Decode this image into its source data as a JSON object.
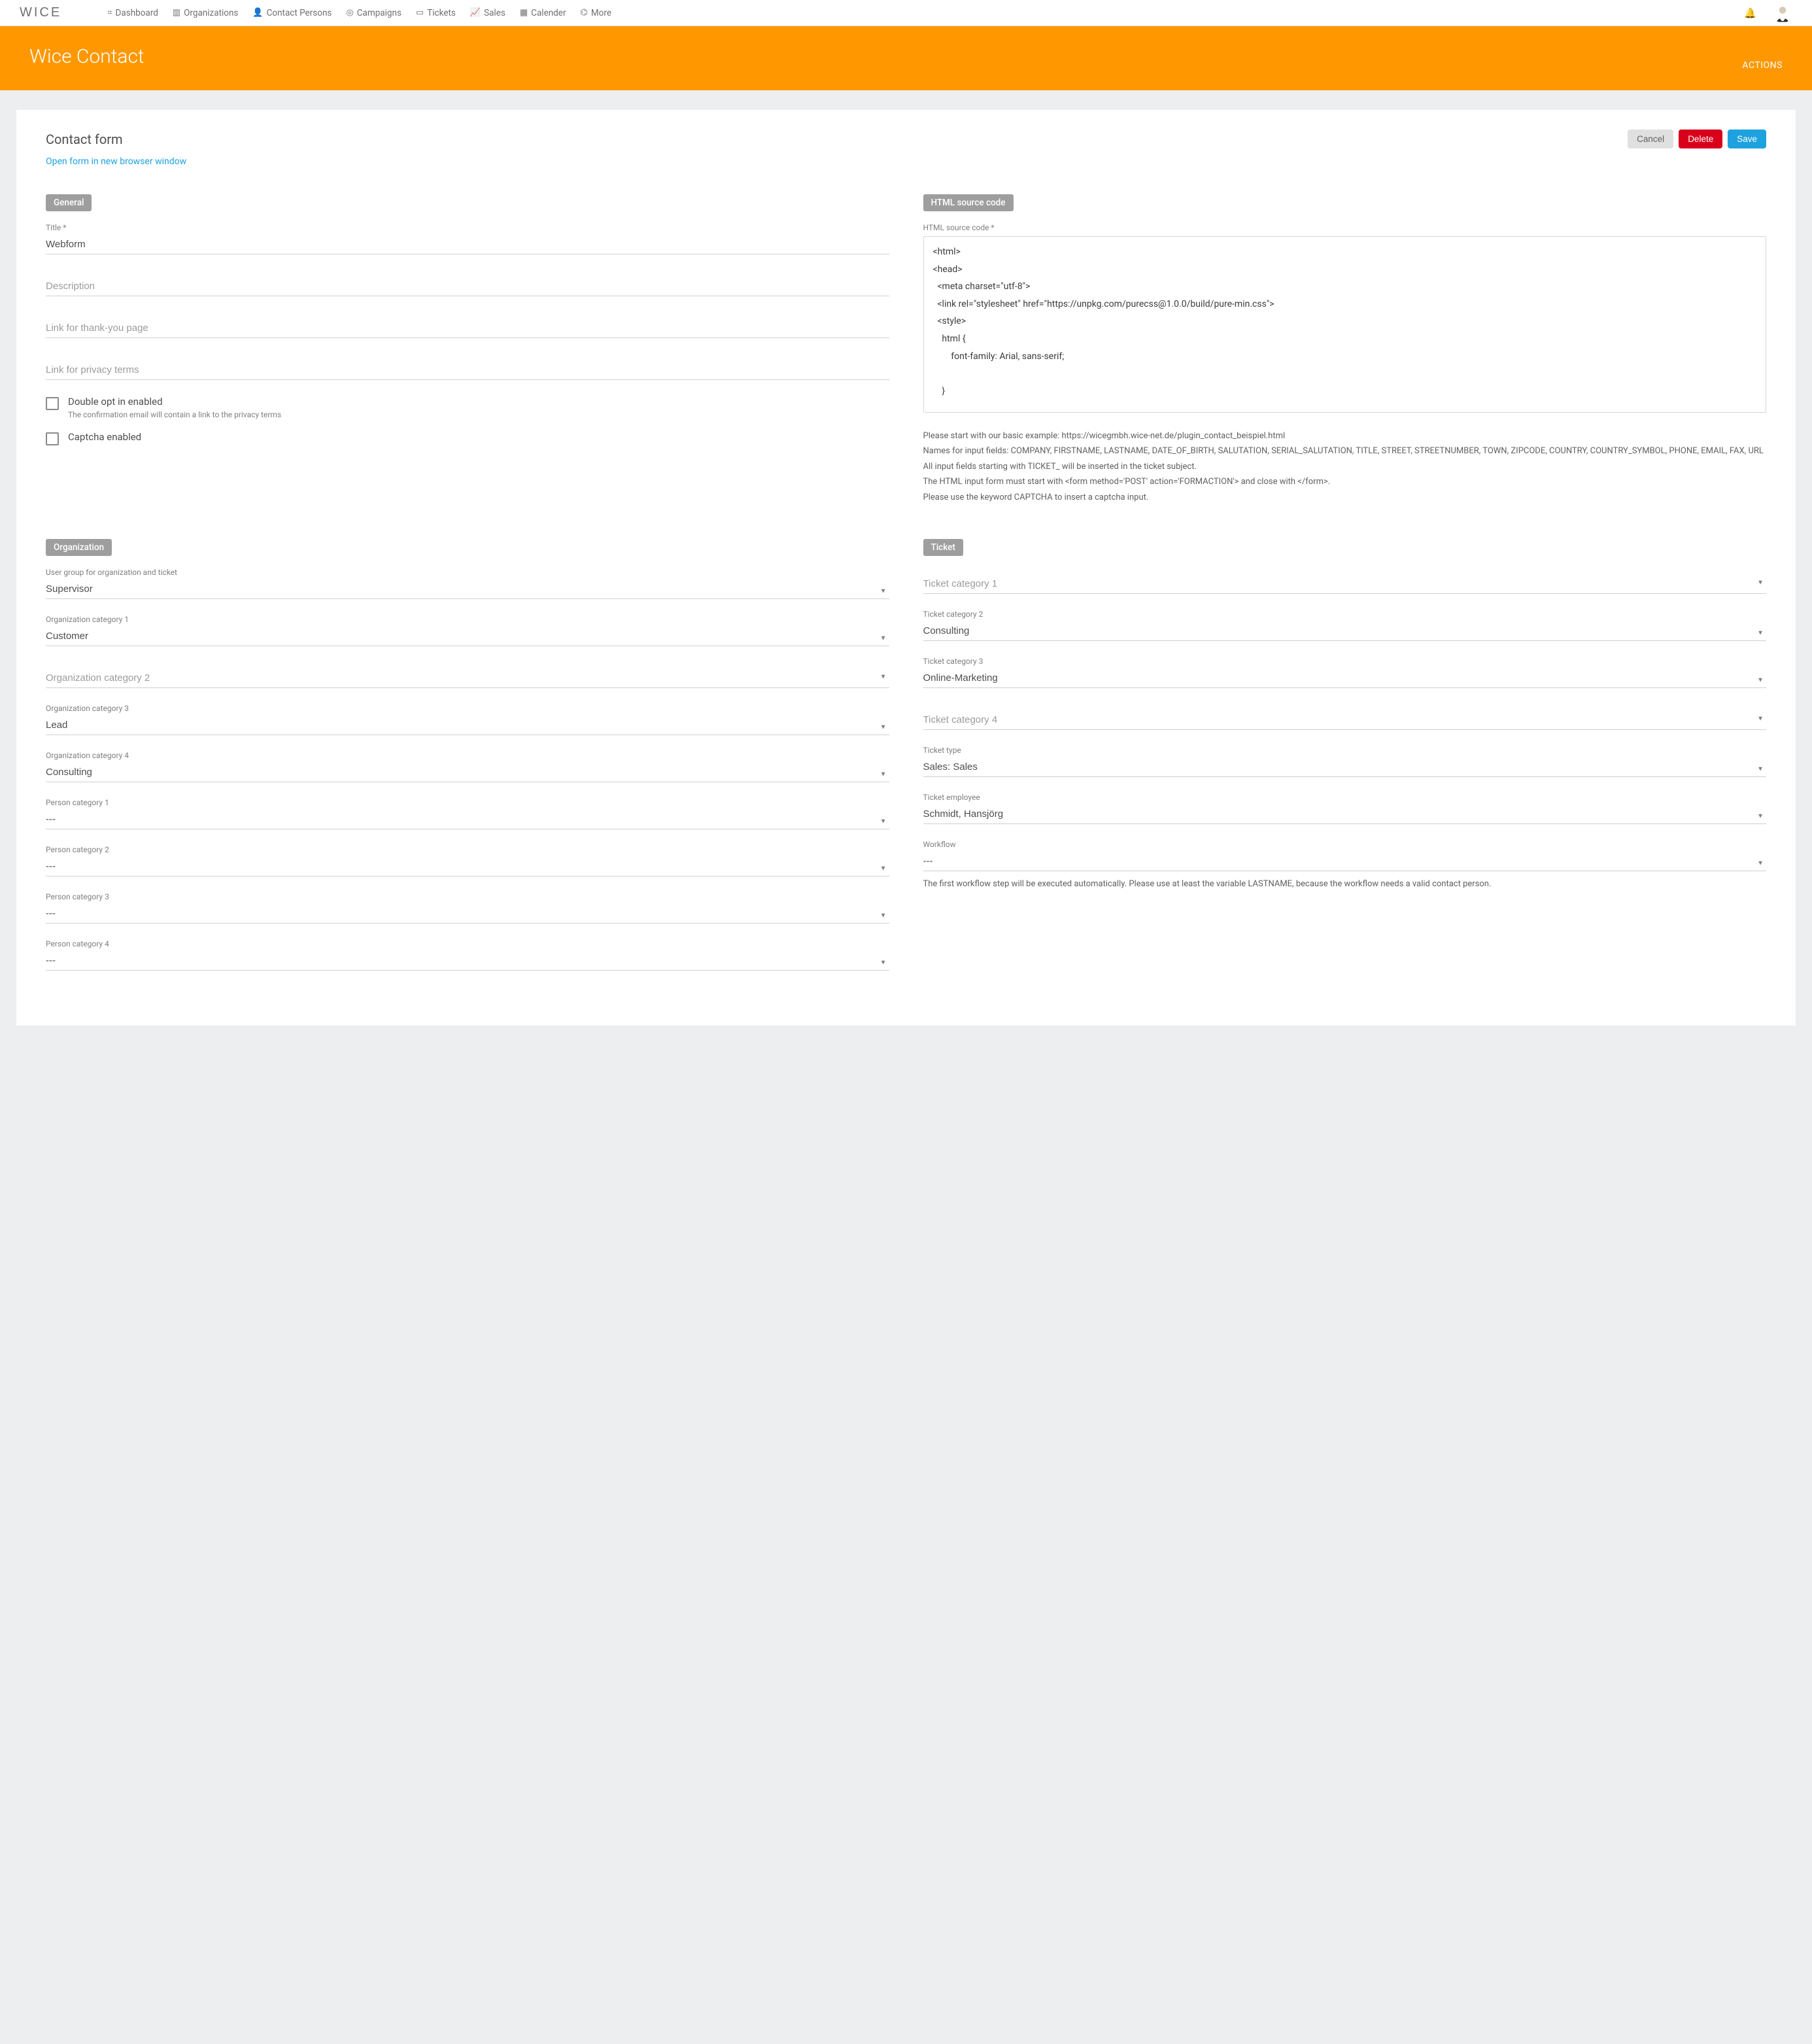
{
  "nav": {
    "logo": "WICE",
    "items": [
      {
        "icon": "dashboard",
        "label": "Dashboard"
      },
      {
        "icon": "building",
        "label": "Organizations"
      },
      {
        "icon": "user",
        "label": "Contact Persons"
      },
      {
        "icon": "target",
        "label": "Campaigns"
      },
      {
        "icon": "briefcase",
        "label": "Tickets"
      },
      {
        "icon": "chart",
        "label": "Sales"
      },
      {
        "icon": "calendar",
        "label": "Calender"
      },
      {
        "icon": "sitemap",
        "label": "More"
      }
    ]
  },
  "hero": {
    "title": "Wice Contact",
    "actions": "ACTIONS"
  },
  "card": {
    "title": "Contact form",
    "buttons": {
      "cancel": "Cancel",
      "delete": "Delete",
      "save": "Save"
    },
    "open_link": "Open form in new browser window"
  },
  "general": {
    "badge": "General",
    "title_label": "Title *",
    "title_value": "Webform",
    "description_placeholder": "Description",
    "thankyou_placeholder": "Link for thank-you page",
    "privacy_placeholder": "Link for privacy terms",
    "double_optin": {
      "label": "Double opt in enabled",
      "sub": "The confirmation email will contain a link to the privacy terms"
    },
    "captcha_label": "Captcha enabled"
  },
  "source": {
    "badge": "HTML source code",
    "label": "HTML source code *",
    "code": "<html>\n<head>\n  <meta charset=\"utf-8\">\n  <link rel=\"stylesheet\" href=\"https://unpkg.com/purecss@1.0.0/build/pure-min.css\">\n  <style>\n    html {\n        font-family: Arial, sans-serif;\n\n    }",
    "help": {
      "line1": "Please start with our basic example: https://wicegmbh.wice-net.de/plugin_contact_beispiel.html",
      "line2": "Names for input fields: COMPANY, FIRSTNAME, LASTNAME, DATE_OF_BIRTH, SALUTATION, SERIAL_SALUTATION, TITLE, STREET, STREETNUMBER, TOWN, ZIPCODE, COUNTRY, COUNTRY_SYMBOL, PHONE, EMAIL, FAX, URL",
      "line3": "All input fields starting with TICKET_ will be inserted in the ticket subject.",
      "line4": "The HTML input form must start with <form method='POST' action='FORMACTION'> and close with </form>.",
      "line5": "Please use the keyword CAPTCHA to insert a captcha input."
    }
  },
  "organization": {
    "badge": "Organization",
    "user_group": {
      "label": "User group for organization and ticket",
      "value": "Supervisor"
    },
    "cat1": {
      "label": "Organization category 1",
      "value": "Customer"
    },
    "cat2": {
      "placeholder": "Organization category 2"
    },
    "cat3": {
      "label": "Organization category 3",
      "value": "Lead"
    },
    "cat4": {
      "label": "Organization category 4",
      "value": "Consulting"
    },
    "pcat1": {
      "label": "Person category 1",
      "value": "---"
    },
    "pcat2": {
      "label": "Person category 2",
      "value": "---"
    },
    "pcat3": {
      "label": "Person category 3",
      "value": "---"
    },
    "pcat4": {
      "label": "Person category 4",
      "value": "---"
    }
  },
  "ticket": {
    "badge": "Ticket",
    "cat1": {
      "placeholder": "Ticket category 1"
    },
    "cat2": {
      "label": "Ticket category 2",
      "value": "Consulting"
    },
    "cat3": {
      "label": "Ticket category 3",
      "value": "Online-Marketing"
    },
    "cat4": {
      "placeholder": "Ticket category 4"
    },
    "type": {
      "label": "Ticket type",
      "value": "Sales: Sales"
    },
    "employee": {
      "label": "Ticket employee",
      "value": "Schmidt, Hansjörg"
    },
    "workflow": {
      "label": "Workflow",
      "value": "---"
    },
    "workflow_help": "The first workflow step will be executed automatically. Please use at least the variable LASTNAME, because the workflow needs a valid contact person."
  }
}
